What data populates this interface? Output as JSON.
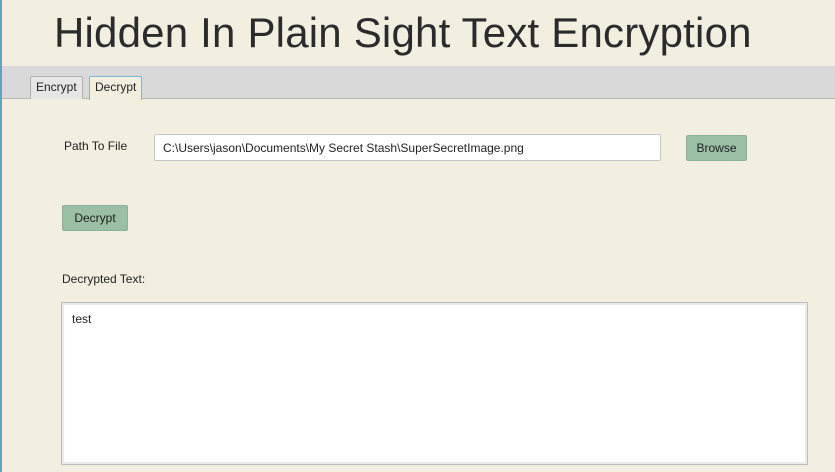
{
  "app": {
    "title": "Hidden In Plain Sight Text Encryption"
  },
  "tabs": [
    {
      "label": "Encrypt",
      "selected": false
    },
    {
      "label": "Decrypt",
      "selected": true
    }
  ],
  "decrypt_form": {
    "path_label": "Path To File",
    "path_value": "C:\\Users\\jason\\Documents\\My Secret Stash\\SuperSecretImage.png",
    "browse_label": "Browse",
    "decrypt_label": "Decrypt",
    "output_label": "Decrypted Text:",
    "output_value": "test"
  },
  "colors": {
    "background": "#f2efe0",
    "button": "#9bbfa5",
    "tab_strip": "#d9d9d9",
    "accent": "#5aa6c4"
  }
}
